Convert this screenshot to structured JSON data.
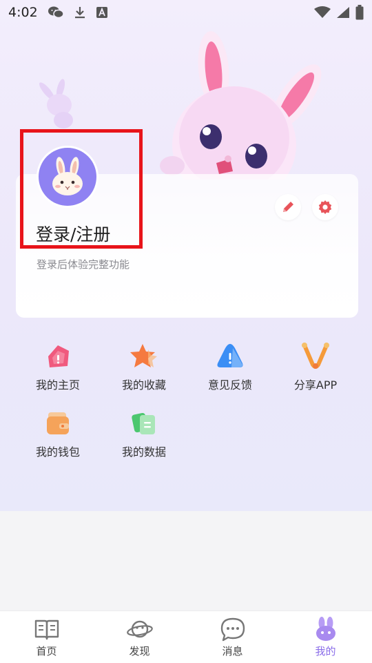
{
  "status_bar": {
    "time": "4:02",
    "left_icons": [
      "wechat-icon",
      "download-icon",
      "a-icon"
    ],
    "right_icons": [
      "wifi-icon",
      "signal-icon",
      "battery-icon"
    ]
  },
  "profile": {
    "title": "登录/注册",
    "subtitle": "登录后体验完整功能",
    "avatar_icon": "rabbit-avatar-icon",
    "edit_icon": "pencil-icon",
    "settings_icon": "gear-icon"
  },
  "menu": {
    "items": [
      {
        "label": "我的主页",
        "icon": "home-page-icon",
        "color": "#f05a7e"
      },
      {
        "label": "我的收藏",
        "icon": "star-icon",
        "color": "#f57a40"
      },
      {
        "label": "意见反馈",
        "icon": "feedback-icon",
        "color": "#3b8ef5"
      },
      {
        "label": "分享APP",
        "icon": "share-icon",
        "color": "#f59a3a"
      },
      {
        "label": "我的钱包",
        "icon": "wallet-icon",
        "color": "#f5a35a"
      },
      {
        "label": "我的数据",
        "icon": "data-icon",
        "color": "#4cc770"
      }
    ]
  },
  "bottom_nav": {
    "items": [
      {
        "label": "首页",
        "icon": "book-icon",
        "active": false
      },
      {
        "label": "发现",
        "icon": "planet-icon",
        "active": false
      },
      {
        "label": "消息",
        "icon": "message-icon",
        "active": false
      },
      {
        "label": "我的",
        "icon": "rabbit-icon",
        "active": true
      }
    ]
  },
  "colors": {
    "accent": "#8a6de9",
    "avatar_bg": "#8f82f2",
    "highlight": "#e8141a"
  }
}
